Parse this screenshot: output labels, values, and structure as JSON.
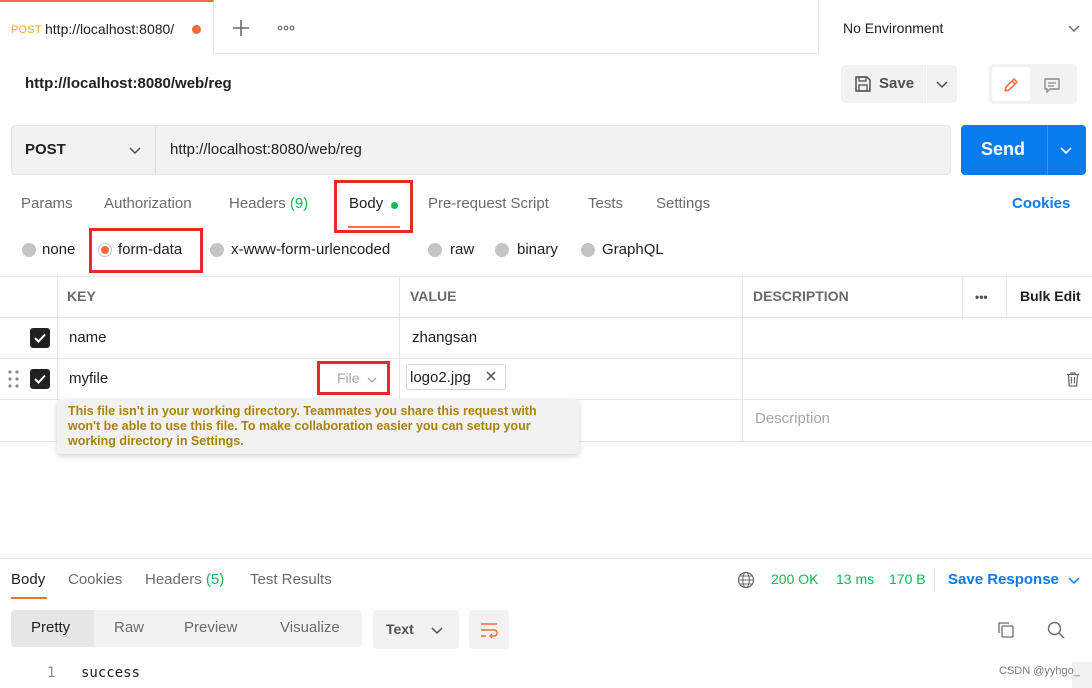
{
  "tab": {
    "method": "POST",
    "url": "http://localhost:8080/",
    "add_icon": "plus-icon",
    "more_icon": "ellipsis-icon"
  },
  "environment": {
    "label": "No Environment"
  },
  "request": {
    "title": "http://localhost:8080/web/reg",
    "save_label": "Save",
    "method": "POST",
    "url": "http://localhost:8080/web/reg",
    "send_label": "Send"
  },
  "request_tabs": [
    {
      "label": "Params"
    },
    {
      "label": "Authorization"
    },
    {
      "label": "Headers",
      "count": "(9)"
    },
    {
      "label": "Body"
    },
    {
      "label": "Pre-request Script"
    },
    {
      "label": "Tests"
    },
    {
      "label": "Settings"
    }
  ],
  "cookies_label": "Cookies",
  "body_types": [
    {
      "label": "none"
    },
    {
      "label": "form-data",
      "selected": true
    },
    {
      "label": "x-www-form-urlencoded"
    },
    {
      "label": "raw"
    },
    {
      "label": "binary"
    },
    {
      "label": "GraphQL"
    }
  ],
  "table": {
    "headers": {
      "key": "KEY",
      "value": "VALUE",
      "description": "DESCRIPTION",
      "more": "•••",
      "bulk": "Bulk Edit"
    },
    "rows": [
      {
        "key": "name",
        "value": "zhangsan",
        "checked": true
      },
      {
        "key": "myfile",
        "type": "File",
        "file": "logo2.jpg",
        "checked": true
      }
    ],
    "description_placeholder": "Description",
    "tooltip": "This file isn't in your working directory. Teammates you share this request with won't be able to use this file. To make collaboration easier you can setup your working directory in Settings."
  },
  "response": {
    "tabs": [
      {
        "label": "Body"
      },
      {
        "label": "Cookies"
      },
      {
        "label": "Headers",
        "count": "(5)"
      },
      {
        "label": "Test Results"
      }
    ],
    "status": "200 OK",
    "time": "13 ms",
    "size": "170 B",
    "save_label": "Save Response",
    "view_modes": [
      "Pretty",
      "Raw",
      "Preview",
      "Visualize"
    ],
    "format": "Text",
    "line_number": "1",
    "content": "success"
  },
  "watermark": "CSDN @yyhgo_",
  "colors": {
    "accent": "#ff6c37",
    "primary": "#097bed",
    "success": "#0cbb52",
    "highlight": "#e32b2b",
    "warning": "#a8820d"
  }
}
